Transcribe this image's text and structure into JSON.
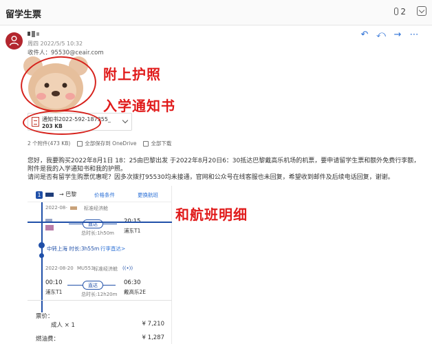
{
  "email": {
    "subject": "留学生票",
    "attachment_count": "2",
    "date": "周四 2022/5/5 10:32",
    "to_label": "收件人：",
    "to_address": "95530@ceair.com"
  },
  "attachment": {
    "file_name": "通知书2022-592-187355_...",
    "file_size": "203 KB",
    "summary": "2 个附件(473 KB)",
    "save_all_label": "全部保存到 OneDrive",
    "download_all_label": "全部下载"
  },
  "annotations": {
    "passport": "附上护照",
    "admission": "入学通知书",
    "flight_details": "和航班明细"
  },
  "body": {
    "line1": "您好，我要购买2022年8月1日 18：25由巴黎出发 于2022年8月20日6：30抵达巴黎戴高乐机场的机票，要申请留学生票和额外免费行李额，",
    "line2": "附件是我的入学通知书和我的护照。",
    "line3": "请问是否有留学生购票优惠呢？因多次拨打95530均未接通，官网和公众号在线客服也未回复，希望收到邮件及后续电话回复，谢谢。"
  },
  "itinerary": {
    "leg_number": "1",
    "dest_arrow": "→ 巴黎",
    "price_conditions": "价格条件",
    "change_flight": "更换航班",
    "leg1": {
      "date": "2022-08-",
      "cabin": "标准经济舱",
      "direct": "直达",
      "arr_time": "20:15",
      "arr_port": "浦东T1",
      "duration": "总时长:1h50m"
    },
    "transfer": "中转上海 时长:3h55m",
    "direct_link": "行李直达>",
    "leg2": {
      "date": "2022-08-20",
      "flight": "MU553",
      "cabin": "标准经济舱",
      "dep_time": "00:10",
      "dep_port": "浦东T1",
      "direct": "直达",
      "duration": "总时长:12h20m",
      "arr_time": "06:30",
      "arr_port": "戴高乐2E"
    },
    "price_title": "票价：",
    "adult_label": "成人 × 1",
    "adult_price": "¥ 7,210",
    "fuel_label": "燃油费：",
    "fuel_price": "¥ 1,287"
  },
  "colors": {
    "accent_blue": "#2a6fd6",
    "itinerary_blue": "#1f4fa8",
    "annotation_red": "#e01a1a",
    "avatar_red": "#b3262e"
  }
}
